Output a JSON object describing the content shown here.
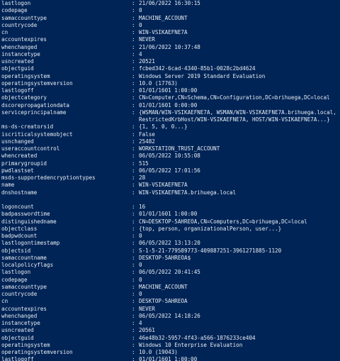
{
  "colors": {
    "background": "#012456",
    "text": "#e8edf4"
  },
  "rows": [
    {
      "key": "lastlogon",
      "value": "21/06/2022 16:30:15"
    },
    {
      "key": "codepage",
      "value": "0"
    },
    {
      "key": "samaccounttype",
      "value": "MACHINE_ACCOUNT"
    },
    {
      "key": "countrycode",
      "value": "0"
    },
    {
      "key": "cn",
      "value": "WIN-VSIKAEFNE7A"
    },
    {
      "key": "accountexpires",
      "value": "NEVER"
    },
    {
      "key": "whenchanged",
      "value": "21/06/2022 10:37:48"
    },
    {
      "key": "instancetype",
      "value": "4"
    },
    {
      "key": "usncreated",
      "value": "20521"
    },
    {
      "key": "objectguid",
      "value": "fcbed342-6cad-4340-85b1-0028c2bd4624"
    },
    {
      "key": "operatingsystem",
      "value": "Windows Server 2019 Standard Evaluation"
    },
    {
      "key": "operatingsystemversion",
      "value": "10.0 (17763)"
    },
    {
      "key": "lastlogoff",
      "value": "01/01/1601 1:00:00"
    },
    {
      "key": "objectcategory",
      "value": "CN=Computer,CN=Schema,CN=Configuration,DC=brihuega,DC=local"
    },
    {
      "key": "dscorepropagationdata",
      "value": "01/01/1601 0:00:00"
    },
    {
      "key": "serviceprincipalname",
      "value": "{WSMAN/WIN-VSIKAEFNE7A, WSMAN/WIN-VSIKAEFNE7A.brihuega.local,"
    },
    {
      "key": "",
      "value": "RestrictedKrbHost/WIN-VSIKAEFNE7A, HOST/WIN-VSIKAEFNE7A...}",
      "cont": true
    },
    {
      "key": "ms-ds-creatorsid",
      "value": "{1, 5, 0, 0...}"
    },
    {
      "key": "iscriticalsystemobject",
      "value": "False"
    },
    {
      "key": "usnchanged",
      "value": "25482"
    },
    {
      "key": "useraccountcontrol",
      "value": "WORKSTATION_TRUST_ACCOUNT"
    },
    {
      "key": "whencreated",
      "value": "06/05/2022 10:55:08"
    },
    {
      "key": "primarygroupid",
      "value": "515"
    },
    {
      "key": "pwdlastset",
      "value": "06/05/2022 17:01:56"
    },
    {
      "key": "msds-supportedencryptiontypes",
      "value": "28"
    },
    {
      "key": "name",
      "value": "WIN-VSIKAEFNE7A"
    },
    {
      "key": "dnshostname",
      "value": "WIN-VSIKAEFNE7A.brihuega.local"
    },
    {
      "blank": true
    },
    {
      "key": "logoncount",
      "value": "16"
    },
    {
      "key": "badpasswordtime",
      "value": "01/01/1601 1:00:00"
    },
    {
      "key": "distinguishedname",
      "value": "CN=DESKTOP-5AHREOA,CN=Computers,DC=brihuega,DC=local"
    },
    {
      "key": "objectclass",
      "value": "{top, person, organizationalPerson, user...}"
    },
    {
      "key": "badpwdcount",
      "value": "0"
    },
    {
      "key": "lastlogontimestamp",
      "value": "06/05/2022 13:13:20"
    },
    {
      "key": "objectsid",
      "value": "S-1-5-21-779589773-409887251-3961271885-1120"
    },
    {
      "key": "samaccountname",
      "value": "DESKTOP-5AHREOA$"
    },
    {
      "key": "localpolicyflags",
      "value": "0"
    },
    {
      "key": "lastlogon",
      "value": "06/05/2022 20:41:45"
    },
    {
      "key": "codepage",
      "value": "0"
    },
    {
      "key": "samaccounttype",
      "value": "MACHINE_ACCOUNT"
    },
    {
      "key": "countrycode",
      "value": "0"
    },
    {
      "key": "cn",
      "value": "DESKTOP-5AHREOA"
    },
    {
      "key": "accountexpires",
      "value": "NEVER"
    },
    {
      "key": "whenchanged",
      "value": "06/05/2022 14:18:26"
    },
    {
      "key": "instancetype",
      "value": "4"
    },
    {
      "key": "usncreated",
      "value": "20561"
    },
    {
      "key": "objectguid",
      "value": "46e48b32-5957-4f43-a566-1876233ce404"
    },
    {
      "key": "operatingsystem",
      "value": "Windows 10 Enterprise Evaluation"
    },
    {
      "key": "operatingsystemversion",
      "value": "10.0 (19043)"
    },
    {
      "key": "lastlogoff",
      "value": "01/01/1601 1:00:00"
    }
  ]
}
